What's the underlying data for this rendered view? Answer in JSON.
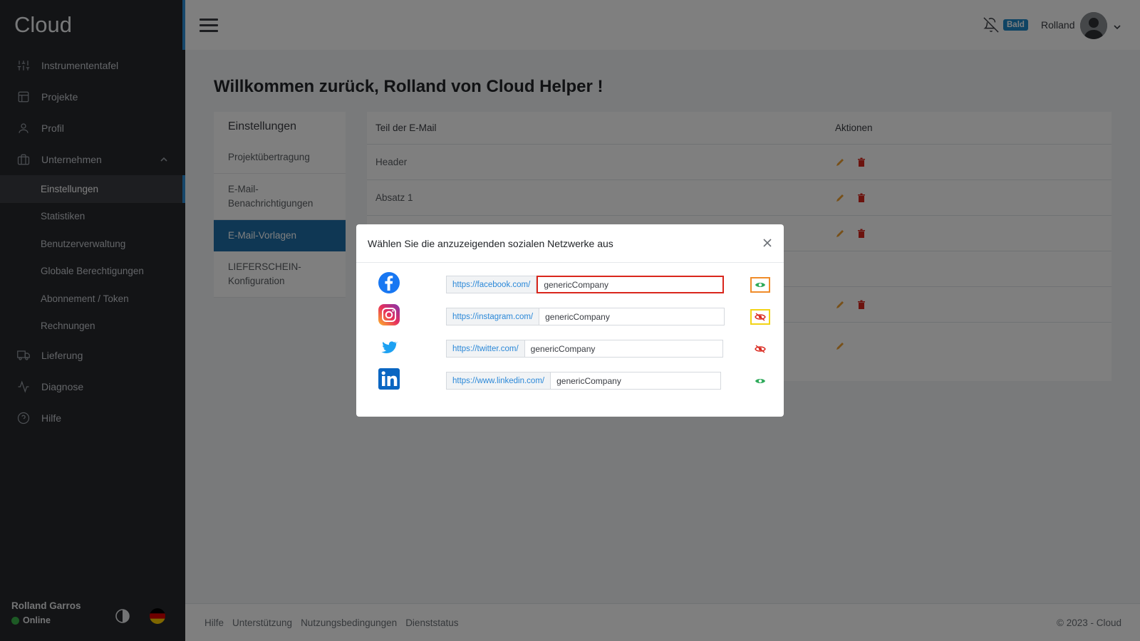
{
  "app": {
    "brand": "Cloud"
  },
  "sidebar": {
    "items": [
      {
        "label": "Instrumententafel",
        "icon": "sliders-icon"
      },
      {
        "label": "Projekte",
        "icon": "layout-icon"
      },
      {
        "label": "Profil",
        "icon": "user-icon"
      },
      {
        "label": "Unternehmen",
        "icon": "briefcase-icon"
      }
    ],
    "submenu": [
      {
        "label": "Einstellungen",
        "active": true
      },
      {
        "label": "Statistiken"
      },
      {
        "label": "Benutzerverwaltung"
      },
      {
        "label": "Globale Berechtigungen"
      },
      {
        "label": "Abonnement / Token"
      },
      {
        "label": "Rechnungen"
      }
    ],
    "items_bottom": [
      {
        "label": "Lieferung",
        "icon": "truck-icon"
      },
      {
        "label": "Diagnose",
        "icon": "activity-icon"
      },
      {
        "label": "Hilfe",
        "icon": "help-circle-icon"
      }
    ],
    "user": {
      "name": "Rolland Garros",
      "status": "Online"
    }
  },
  "topbar": {
    "badge": "Bald",
    "username": "Rolland"
  },
  "main": {
    "welcome": "Willkommen zurück, Rolland von Cloud Helper !",
    "settings_menu": {
      "title": "Einstellungen",
      "items": [
        "Projektübertragung",
        "E-Mail-Benachrichtigungen",
        "E-Mail-Vorlagen",
        "LIEFERSCHEIN-Konfiguration"
      ],
      "active_index": 2
    },
    "table": {
      "headers": [
        "Teil der E-Mail",
        "Aktionen"
      ],
      "rows": [
        "Header",
        "Absatz 1",
        "",
        "",
        "",
        ""
      ]
    }
  },
  "modal": {
    "title": "Wählen Sie die anzuzeigenden sozialen Netzwerke aus",
    "networks": [
      {
        "name": "facebook",
        "prefix": "https://facebook.com/",
        "value": "genericCompany",
        "visible": true
      },
      {
        "name": "instagram",
        "prefix": "https://instagram.com/",
        "value": "genericCompany",
        "visible": false
      },
      {
        "name": "twitter",
        "prefix": "https://twitter.com/",
        "value": "genericCompany",
        "visible": false
      },
      {
        "name": "linkedin",
        "prefix": "https://www.linkedin.com/",
        "value": "genericCompany",
        "visible": true
      }
    ]
  },
  "footer": {
    "links": [
      "Hilfe",
      "Unterstützung",
      "Nutzungsbedingungen",
      "Dienststatus"
    ],
    "copyright": "© 2023 - Cloud"
  },
  "colors": {
    "accent": "#1e6fa8",
    "edit": "#f0a030",
    "delete": "#d9261c",
    "visible": "#2eaa5a",
    "hidden": "#d9261c"
  }
}
